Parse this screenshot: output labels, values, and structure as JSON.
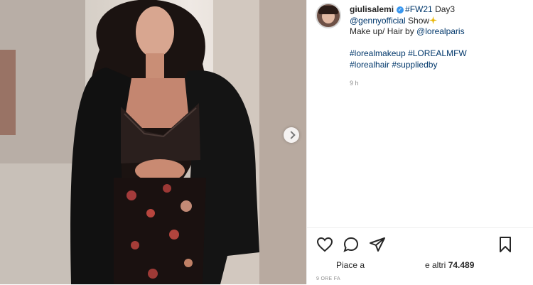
{
  "post": {
    "username": "giulisalemi",
    "caption": {
      "hashtag_fw21": "#FW21",
      "day_text": "Day3",
      "mention_genny": "@gennyofficial",
      "show_text": "Show",
      "makeup_text": "Make up/ Hair by",
      "mention_loreal": "@lorealparis",
      "tag_makeup": "#lorealmakeup",
      "tag_mfw": "#LOREALMFW",
      "tag_hair": "#lorealhair",
      "tag_supplied": "#suppliedby"
    },
    "comment_time": "9 h"
  },
  "actions": {
    "liked_by_label": "Piace a",
    "others_label": "e altri",
    "others_count": "74.489",
    "post_time": "9 ORE FA"
  },
  "icons": {
    "like": "heart-icon",
    "comment": "comment-icon",
    "share": "paper-plane-icon",
    "save": "bookmark-icon",
    "verified": "verified-badge-icon",
    "next": "chevron-right-icon"
  },
  "colors": {
    "link": "#00376b",
    "verified": "#3897f0",
    "muted": "#8e8e8e"
  }
}
